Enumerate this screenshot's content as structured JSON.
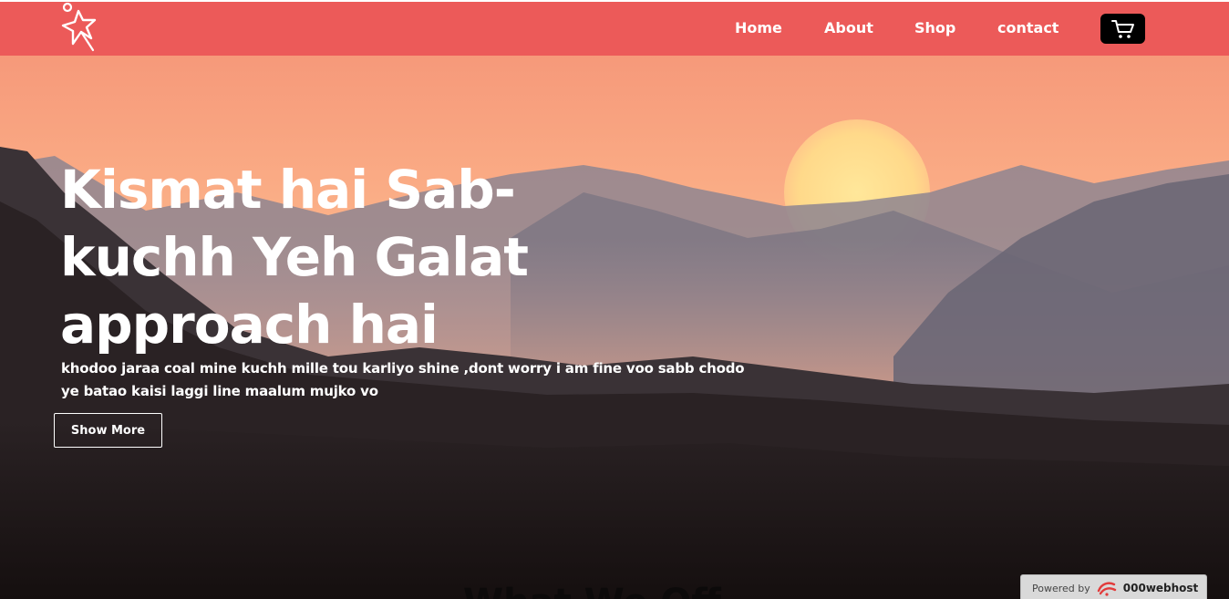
{
  "nav": {
    "links": [
      "Home",
      "About",
      "Shop",
      "contact"
    ],
    "logo_icon": "star-logo-icon",
    "cart_icon": "cart-icon"
  },
  "hero": {
    "headline_lines": [
      "Kismat hai Sab-",
      "kuchh Yeh Galat",
      "approach hai"
    ],
    "subtext_lines": [
      "khodoo jaraa coal mine kuchh mille tou karliyo shine ,dont worry i am fine voo sabb chodo",
      "ye batao kaisi laggi line maalum mujko vo"
    ],
    "button_label": "Show More",
    "next_section_heading_partial": "What We Off"
  },
  "footer_badge": {
    "label": "Powered by",
    "brand": "000webhost",
    "icon": "webhost-logo-icon"
  },
  "colors": {
    "navbar": "#ec5a59",
    "cart_bg": "#000000",
    "text": "#ffffff"
  }
}
